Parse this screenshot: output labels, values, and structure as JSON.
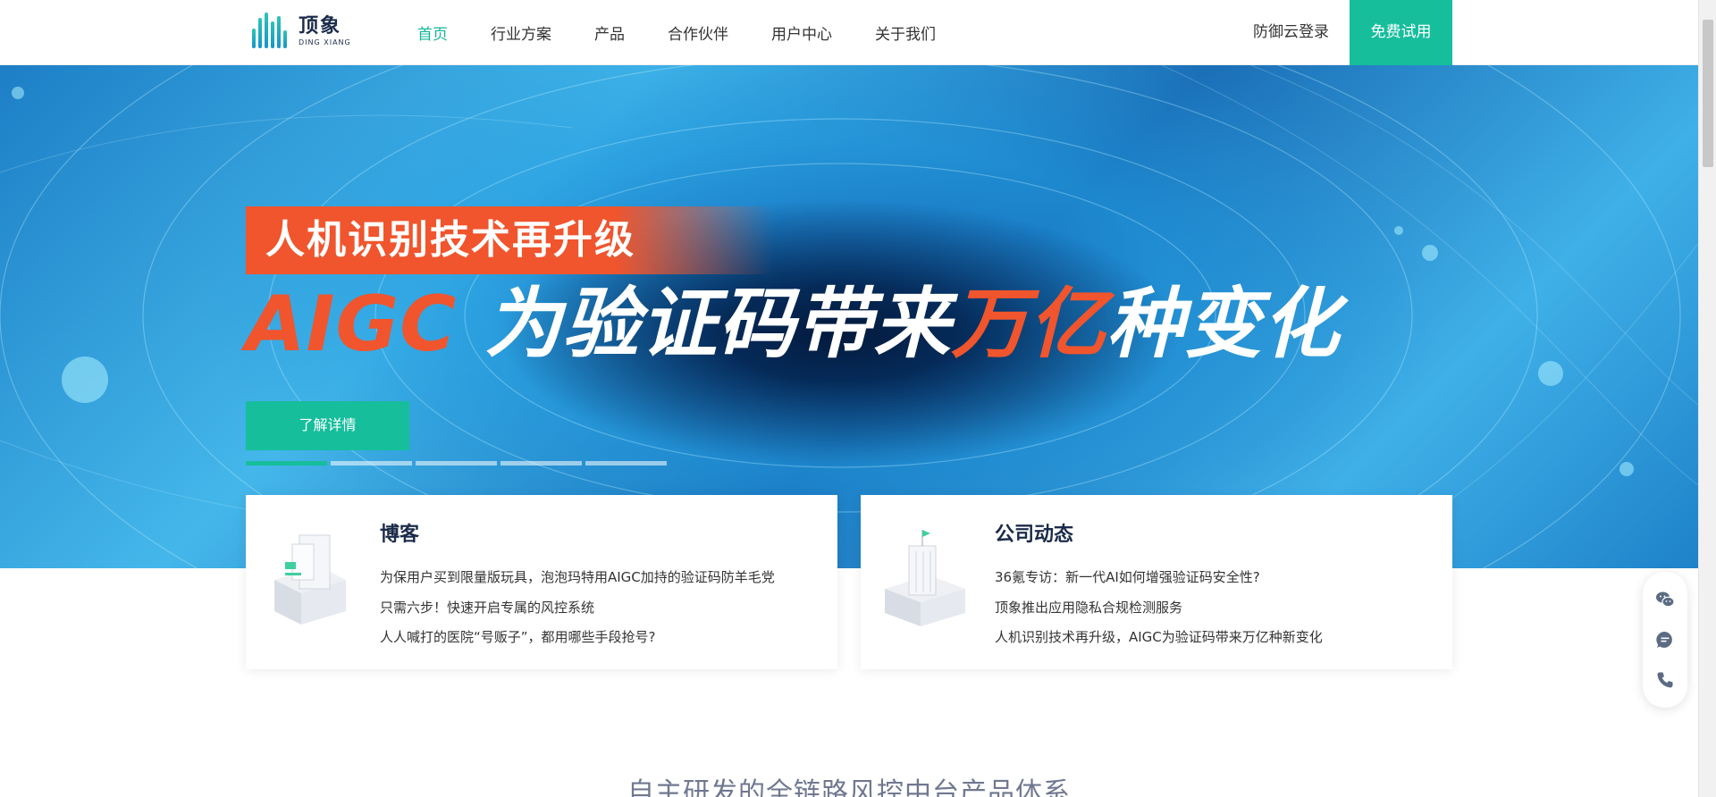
{
  "header": {
    "logo": {
      "cn": "顶象",
      "en": "DING XIANG"
    },
    "nav": [
      "首页",
      "行业方案",
      "产品",
      "合作伙伴",
      "用户中心",
      "关于我们"
    ],
    "active_index": 0,
    "login_label": "防御云登录",
    "trial_label": "免费试用"
  },
  "hero": {
    "subtitle": "人机识别技术再升级",
    "title_part1": "AIGC",
    "title_part2": "为验证码带来",
    "title_part3": "万亿",
    "title_part4": "种变化",
    "button_label": "了解详情",
    "slide_count": 5,
    "active_slide": 0
  },
  "cards": {
    "blog": {
      "title": "博客",
      "items": [
        "为保用户买到限量版玩具，泡泡玛特用AIGC加持的验证码防羊毛党",
        "只需六步！快速开启专属的风控系统",
        "人人喊打的医院“号贩子”，都用哪些手段抢号?"
      ]
    },
    "news": {
      "title": "公司动态",
      "items": [
        "36氪专访：新一代AI如何增强验证码安全性?",
        "顶象推出应用隐私合规检测服务",
        "人机识别技术再升级，AIGC为验证码带来万亿种新变化"
      ]
    }
  },
  "side_buttons": [
    "wechat-icon",
    "chat-icon",
    "phone-icon"
  ],
  "section": {
    "title": "自主研发的全链路风控中台产品体系"
  },
  "colors": {
    "accent": "#16be9c",
    "orange": "#f0552d",
    "dark": "#1b2b4a"
  }
}
